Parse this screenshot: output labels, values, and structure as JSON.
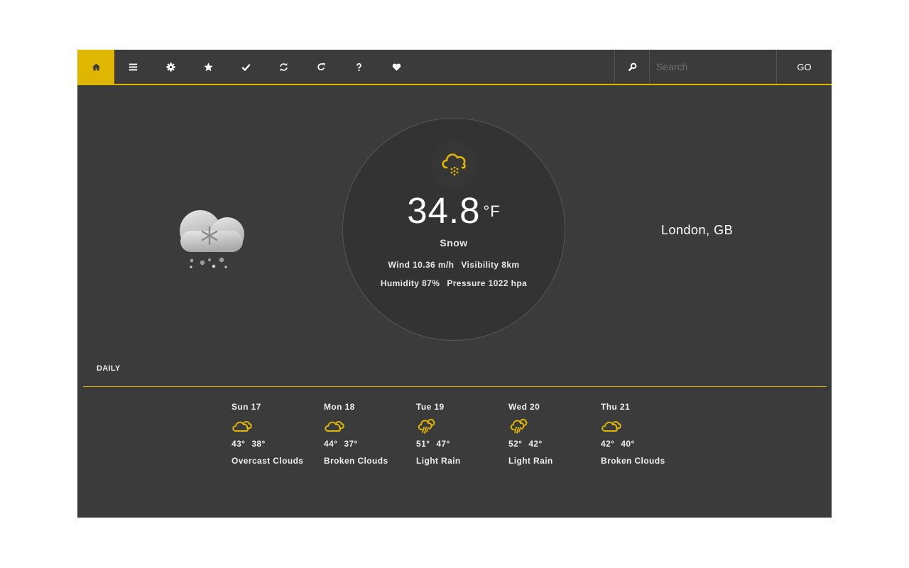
{
  "nav": {
    "items": [
      {
        "name": "home",
        "icon": "home-icon",
        "active": true
      },
      {
        "name": "menu",
        "icon": "menu-icon",
        "active": false
      },
      {
        "name": "settings",
        "icon": "gear-icon",
        "active": false
      },
      {
        "name": "favorites",
        "icon": "star-icon",
        "active": false
      },
      {
        "name": "check",
        "icon": "check-icon",
        "active": false
      },
      {
        "name": "sync",
        "icon": "sync-icon",
        "active": false
      },
      {
        "name": "refresh",
        "icon": "refresh-icon",
        "active": false
      },
      {
        "name": "help",
        "icon": "question-icon",
        "active": false
      },
      {
        "name": "like",
        "icon": "heart-icon",
        "active": false
      }
    ],
    "search": {
      "placeholder": "Search",
      "value": "",
      "icon": "search-icon"
    },
    "go_label": "GO"
  },
  "current": {
    "icon": "snow-night-icon",
    "temperature": "34.8",
    "unit": "°F",
    "condition": "Snow",
    "wind": "Wind 10.36 m/h",
    "visibility": "Visibility 8km",
    "humidity": "Humidity 87%",
    "pressure": "Pressure 1022 hpa",
    "location": "London, GB"
  },
  "daily": {
    "label": "DAILY",
    "days": [
      {
        "day": "Sun 17",
        "icon": "cloudy-icon",
        "high": "43°",
        "low": "38°",
        "desc": "Overcast Clouds"
      },
      {
        "day": "Mon 18",
        "icon": "cloudy-icon",
        "high": "44°",
        "low": "37°",
        "desc": "Broken Clouds"
      },
      {
        "day": "Tue 19",
        "icon": "rain-icon",
        "high": "51°",
        "low": "47°",
        "desc": "Light Rain"
      },
      {
        "day": "Wed 20",
        "icon": "rain-icon",
        "high": "52°",
        "low": "42°",
        "desc": "Light Rain"
      },
      {
        "day": "Thu 21",
        "icon": "cloudy-icon",
        "high": "42°",
        "low": "40°",
        "desc": "Broken Clouds"
      }
    ]
  },
  "colors": {
    "accent": "#dfb700",
    "background": "#3b3b3b",
    "circle": "#333333"
  }
}
